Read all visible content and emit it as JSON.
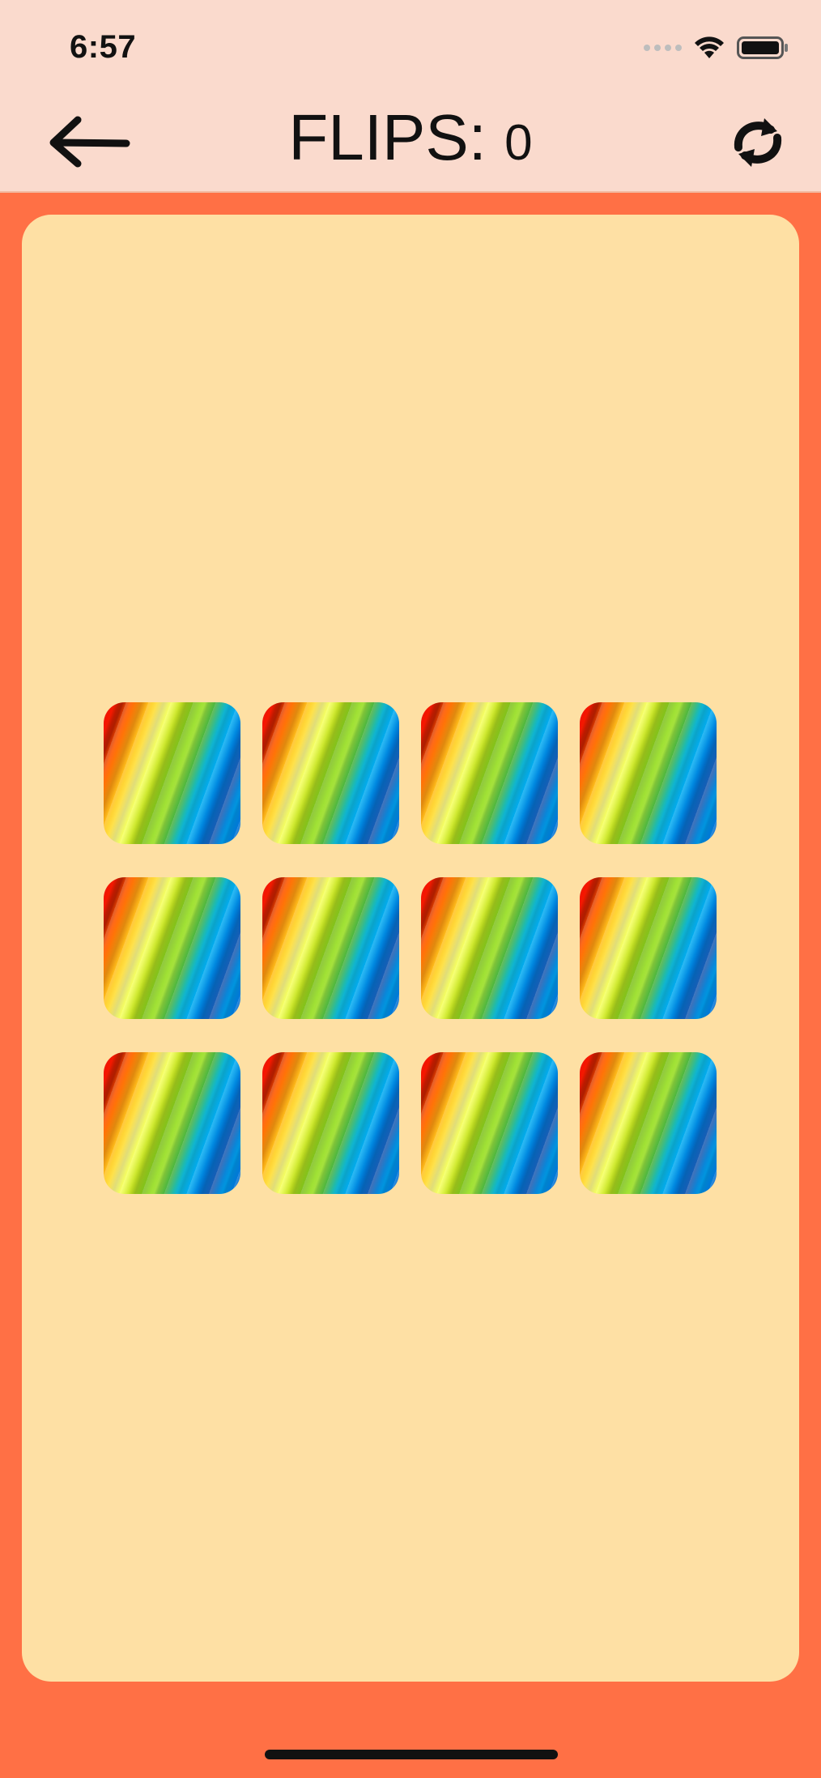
{
  "status_bar": {
    "time": "6:57",
    "wifi_icon": "wifi-icon",
    "battery_icon": "battery-icon",
    "signal_icon": "signal-dots-icon"
  },
  "header": {
    "back_icon": "arrow-left-icon",
    "title_label": "FLIPS: ",
    "flip_count": "0",
    "restart_icon": "refresh-icon",
    "background_color": "#fadacd"
  },
  "board": {
    "background_color": "#fee0a4",
    "outer_color": "#ff7045",
    "rows": 3,
    "columns": 4,
    "card_back": "rainbow-stripes",
    "cards": [
      {
        "state": "face-down"
      },
      {
        "state": "face-down"
      },
      {
        "state": "face-down"
      },
      {
        "state": "face-down"
      },
      {
        "state": "face-down"
      },
      {
        "state": "face-down"
      },
      {
        "state": "face-down"
      },
      {
        "state": "face-down"
      },
      {
        "state": "face-down"
      },
      {
        "state": "face-down"
      },
      {
        "state": "face-down"
      },
      {
        "state": "face-down"
      }
    ]
  }
}
